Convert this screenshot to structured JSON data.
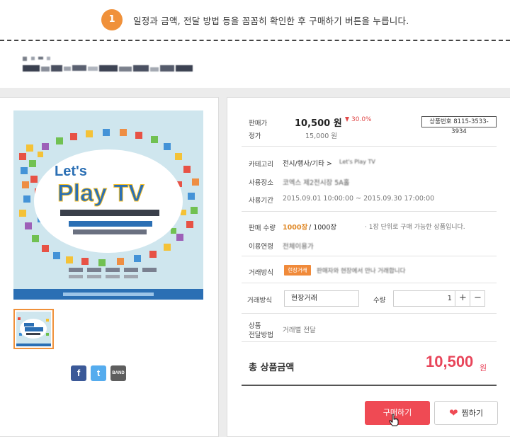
{
  "banner": {
    "step": "1",
    "text": "일정과 금액, 전달 방법 등을 꼼꼼히 확인한 후 구매하기 버튼을 누릅니다."
  },
  "product": {
    "image_title_line1": "Let's",
    "image_title_line2": "Play TV",
    "sale_price_label": "판매가",
    "sale_price": "10,500 원",
    "discount": "30.0%",
    "list_price_label": "정가",
    "list_price": "15,000 원",
    "product_number": "상품번호 8115-3533-3934",
    "category_label": "카테고리",
    "category_path": "전시/행사/기타 >",
    "category_sub": "Let's Play TV",
    "place_label": "사용장소",
    "place_value": "코엑스 제2전시장 5A홀",
    "period_label": "사용기간",
    "period_value": "2015.09.01 10:00:00 ~ 2015.09.30 17:00:00",
    "sales_qty_label": "판매 수량",
    "sales_qty_sold": "1000장",
    "sales_qty_total": "/ 1000장",
    "sales_qty_note": "· 1장 단위로 구매 가능한 상품입니다.",
    "usage_label": "이용연령",
    "usage_value": "전체이용가",
    "trade_method_label": "거래방식",
    "trade_badge": "현장거래",
    "trade_method_detail": "판매자와 현장에서 만나 거래합니다",
    "trade_select_label": "거래방식",
    "trade_select_value": "현장거래",
    "qty_label": "수량",
    "qty_value": "1",
    "qty_plus": "+",
    "qty_minus": "−",
    "delivery_label_line1": "상품",
    "delivery_label_line2": "전달방법",
    "delivery_value": "거래별 전달",
    "total_label": "총 상품금액",
    "total_price": "10,500",
    "total_unit": "원"
  },
  "actions": {
    "buy": "구매하기",
    "wish": "찜하기"
  },
  "share": {
    "facebook": "f",
    "twitter": "t",
    "band": "BAND"
  },
  "colors": {
    "accent_orange": "#f0913a",
    "buy_red": "#ef4a54",
    "price_red": "#e8455a"
  }
}
